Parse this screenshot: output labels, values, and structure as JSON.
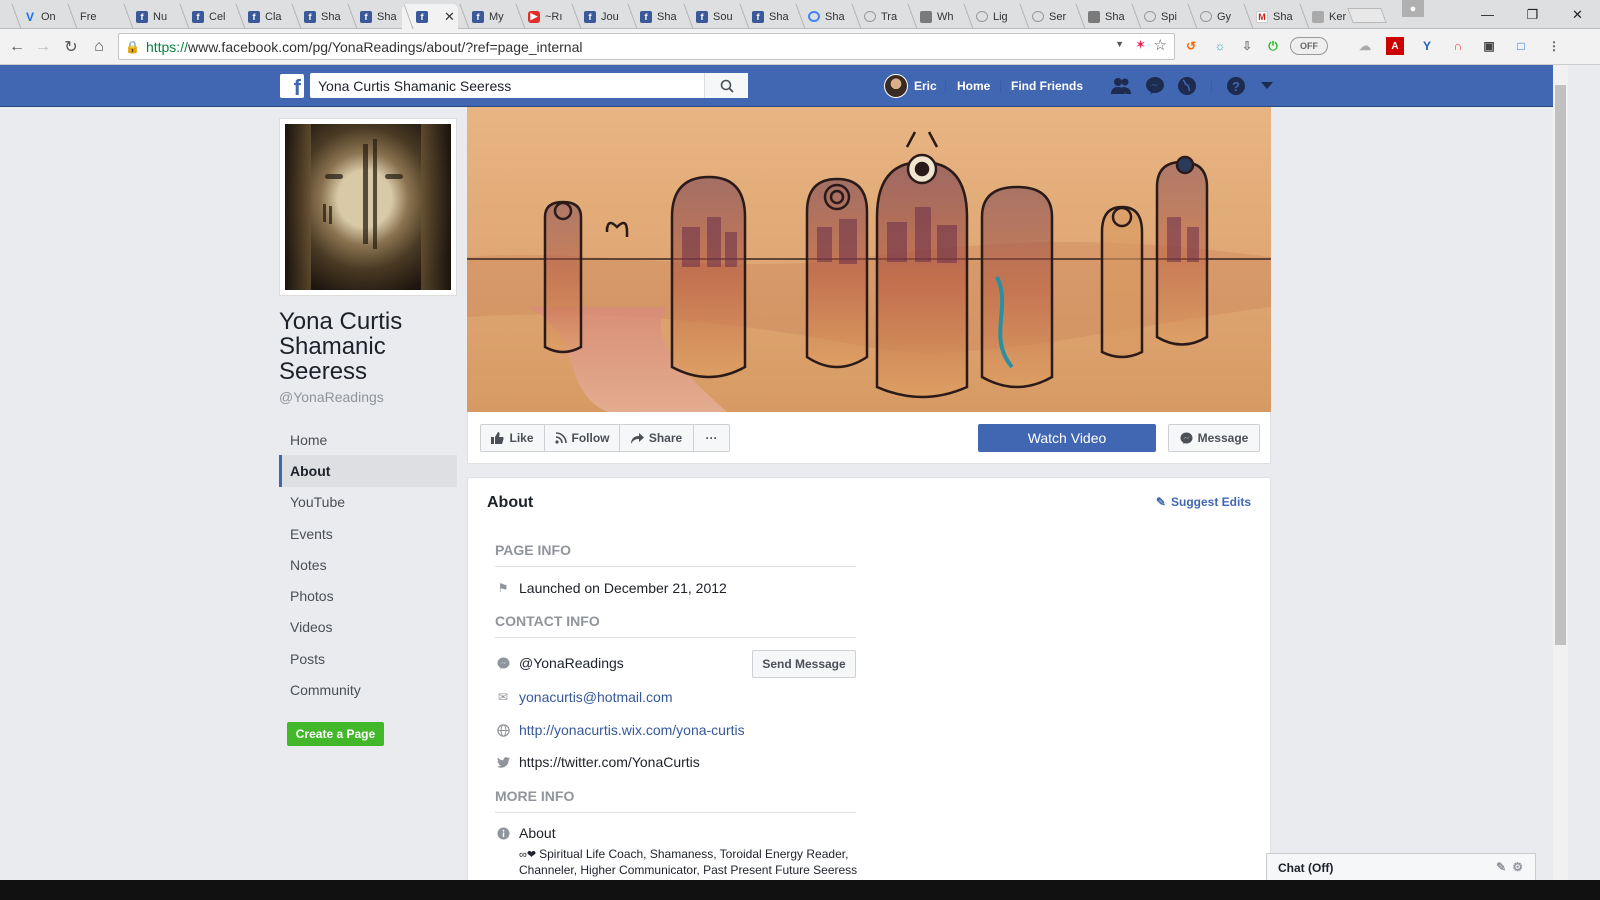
{
  "browser": {
    "tabs": [
      {
        "title": "On",
        "icon": "v"
      },
      {
        "title": "Fre",
        "icon": "none"
      },
      {
        "title": "Nu",
        "icon": "fb"
      },
      {
        "title": "Cel",
        "icon": "fb"
      },
      {
        "title": "Cla",
        "icon": "fb"
      },
      {
        "title": "Sha",
        "icon": "fb"
      },
      {
        "title": "Sha",
        "icon": "fb"
      },
      {
        "title": "",
        "icon": "fb",
        "active": true
      },
      {
        "title": "My",
        "icon": "fb"
      },
      {
        "title": "~Rı",
        "icon": "yt"
      },
      {
        "title": "Jou",
        "icon": "fb"
      },
      {
        "title": "Sha",
        "icon": "fb"
      },
      {
        "title": "Sou",
        "icon": "fb"
      },
      {
        "title": "Sha",
        "icon": "fb"
      },
      {
        "title": "Sha",
        "icon": "cir"
      },
      {
        "title": "Tra",
        "icon": "lt"
      },
      {
        "title": "Wh",
        "icon": "ox"
      },
      {
        "title": "Lig",
        "icon": "lt"
      },
      {
        "title": "Ser",
        "icon": "lt"
      },
      {
        "title": "Sha",
        "icon": "ox"
      },
      {
        "title": "Spi",
        "icon": "lt"
      },
      {
        "title": "Gy",
        "icon": "lt"
      },
      {
        "title": "Sha",
        "icon": "gm"
      },
      {
        "title": "Ker",
        "icon": "jm"
      }
    ],
    "url_scheme": "https://",
    "url_rest": "www.facebook.com/pg/YonaReadings/about/?ref=page_internal",
    "toggle_label": "OFF"
  },
  "fb": {
    "search_value": "Yona Curtis Shamanic Seeress",
    "user_name": "Eric",
    "nav_home": "Home",
    "nav_find_friends": "Find Friends"
  },
  "page": {
    "name": "Yona Curtis Shamanic Seeress",
    "handle": "@YonaReadings",
    "nav": [
      "Home",
      "About",
      "YouTube",
      "Events",
      "Notes",
      "Photos",
      "Videos",
      "Posts",
      "Community"
    ],
    "create_page": "Create a Page"
  },
  "actions": {
    "like": "Like",
    "follow": "Follow",
    "share": "Share",
    "more": "···",
    "watch_video": "Watch Video",
    "message": "Message"
  },
  "about": {
    "title": "About",
    "suggest_edits": "Suggest Edits",
    "page_info_header": "PAGE INFO",
    "launched": "Launched on December 21, 2012",
    "contact_info_header": "CONTACT INFO",
    "messenger": "@YonaReadings",
    "send_message": "Send Message",
    "email": "yonacurtis@hotmail.com",
    "website": "http://yonacurtis.wix.com/yona-curtis",
    "twitter": "https://twitter.com/YonaCurtis",
    "more_info_header": "MORE INFO",
    "about_label": "About",
    "bio": "Spiritual Life Coach, Shamaness, Toroidal Energy Reader, Channeler, Higher Communicator, Past Present Future Seeress"
  },
  "chat": {
    "label": "Chat (Off)"
  },
  "colors": {
    "fb_blue": "#4267b2",
    "link": "#365899",
    "green": "#42b72a",
    "bg": "#e9ebee"
  }
}
